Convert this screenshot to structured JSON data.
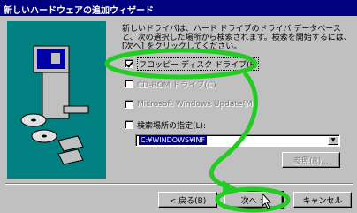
{
  "window": {
    "title": "新しいハードウェアの追加ウィザード"
  },
  "description": "新しいドライバは、ハード ドライブのドライバ データベースと、次の選択した場所から検索されます。検索を開始するには、[次へ] をクリックしてください。",
  "options": [
    {
      "label": "フロッピー ディスク ドライブ(F)",
      "checked": true,
      "enabled": true
    },
    {
      "label": "CD-ROM ドライブ(C)",
      "checked": false,
      "enabled": false
    },
    {
      "label": "Microsoft Windows Update(M)",
      "checked": false,
      "enabled": false
    },
    {
      "label": "検索場所の指定(L):",
      "checked": false,
      "enabled": true
    }
  ],
  "location": {
    "value": "C:¥WINDOWS¥INF"
  },
  "buttons": {
    "browse": "参照(R)...",
    "back": "< 戻る(B)",
    "next": "次へ >",
    "cancel": "キャンセル"
  },
  "annotation_color": "#22cc22"
}
